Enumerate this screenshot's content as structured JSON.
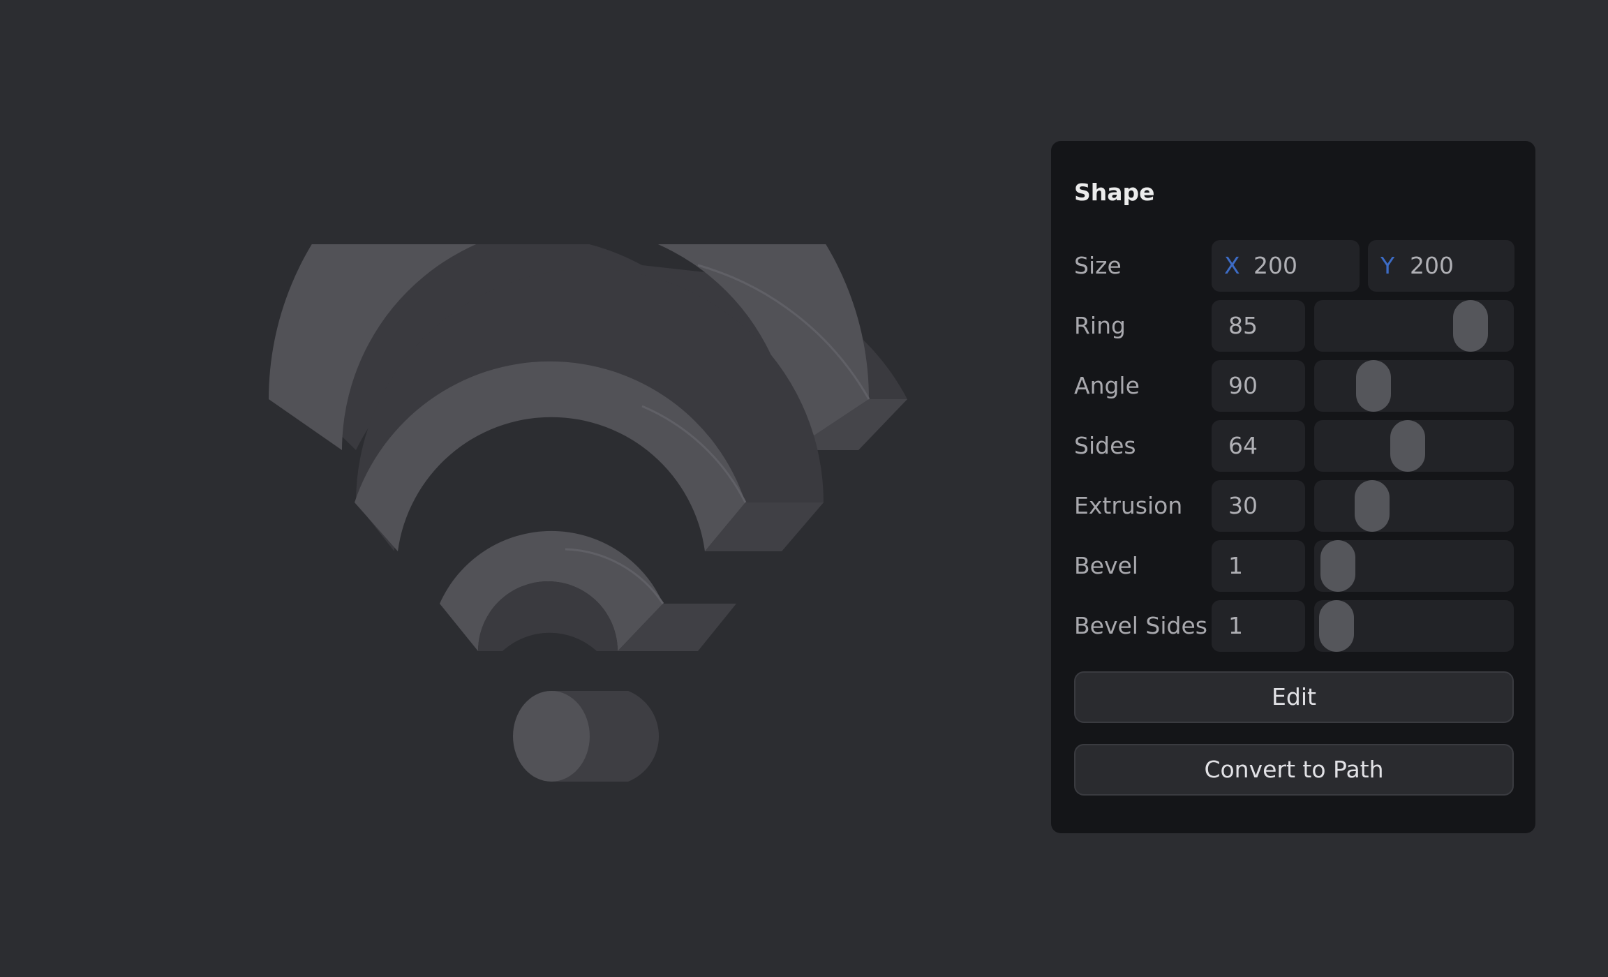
{
  "panel": {
    "title": "Shape",
    "size": {
      "label": "Size",
      "x_axis": "X",
      "x_value": "200",
      "y_axis": "Y",
      "y_value": "200"
    },
    "sliders": [
      {
        "label": "Ring",
        "value": "85",
        "level": 0.85
      },
      {
        "label": "Angle",
        "value": "90",
        "level": 0.25
      },
      {
        "label": "Sides",
        "value": "64",
        "level": 0.46
      },
      {
        "label": "Extrusion",
        "value": "30",
        "level": 0.24
      },
      {
        "label": "Bevel",
        "value": "1",
        "level": 0.03
      },
      {
        "label": "Bevel Sides",
        "value": "1",
        "level": 0.02
      }
    ],
    "buttons": {
      "edit": "Edit",
      "convert": "Convert to Path"
    }
  },
  "colors": {
    "background": "#2c2d31",
    "panel": "#141518",
    "field": "#222327",
    "thumb": "#55565b",
    "axis_accent": "#3d6cc6",
    "shape_face": "#525257",
    "shape_side": "#3b3b40"
  },
  "canvas": {
    "shape_icon": "wifi-3d-shape"
  }
}
